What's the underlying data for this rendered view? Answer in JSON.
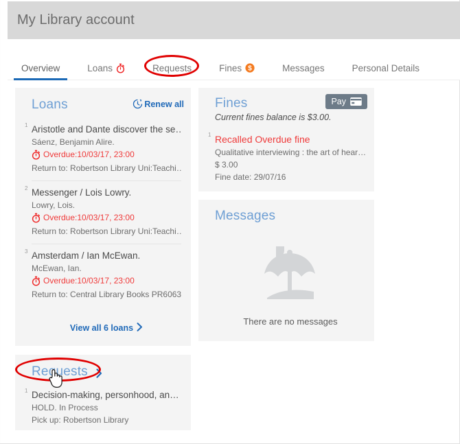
{
  "header": {
    "title": "My Library account"
  },
  "tabs": [
    {
      "label": "Overview",
      "icon": "",
      "active": true
    },
    {
      "label": "Loans",
      "icon": "stopwatch-icon",
      "active": false
    },
    {
      "label": "Requests",
      "icon": "",
      "active": false,
      "highlighted": true
    },
    {
      "label": "Fines",
      "icon": "dollar-badge-icon",
      "active": false
    },
    {
      "label": "Messages",
      "icon": "",
      "active": false
    },
    {
      "label": "Personal Details",
      "icon": "",
      "active": false
    }
  ],
  "loans_card": {
    "title": "Loans",
    "renew_all_label": "Renew all",
    "renew_all_icon": "renew-clock-icon",
    "items": [
      {
        "num": "1",
        "title": "Aristotle and Dante discover the se…",
        "author": "Sáenz, Benjamin Alire.",
        "overdue": "Overdue:10/03/17, 23:00",
        "return_to": "Return to: Robertson Library Uni:Teachi…"
      },
      {
        "num": "2",
        "title": "Messenger / Lois Lowry.",
        "author": "Lowry, Lois.",
        "overdue": "Overdue:10/03/17, 23:00",
        "return_to": "Return to: Robertson Library Uni:Teachi…"
      },
      {
        "num": "3",
        "title": "Amsterdam / Ian McEwan.",
        "author": "McEwan, Ian.",
        "overdue": "Overdue:10/03/17, 23:00",
        "return_to": "Return to: Central Library Books PR6063…"
      }
    ],
    "view_all_label": "View all 6 loans"
  },
  "fines_card": {
    "title": "Fines",
    "pay_label": "Pay",
    "pay_icon": "credit-card-icon",
    "balance": "Current fines balance is $3.00.",
    "items": [
      {
        "num": "1",
        "type": "Recalled Overdue fine",
        "title": "Qualitative interviewing : the art of hear…",
        "amount": "$ 3.00",
        "date": "Fine date: 29/07/16"
      }
    ]
  },
  "messages_card": {
    "title": "Messages",
    "empty_icon": "beach-umbrella-icon",
    "empty_text": "There are no messages"
  },
  "requests_card": {
    "title": "Requests",
    "chevron_icon": "chevron-right-icon",
    "items": [
      {
        "num": "1",
        "title": "Decision-making, personhood, an…",
        "status": "HOLD. In Process",
        "pickup": "Pick up: Robertson Library"
      }
    ]
  },
  "colors": {
    "header_bg": "#d8d8d8",
    "card_bg": "#f4f4f4",
    "accent_blue": "#1f69b8",
    "title_blue": "#6e9fd4",
    "overdue_red": "#ef3a3a",
    "annotation_red": "#e00000",
    "pay_btn": "#6d7b88",
    "fines_badge_orange": "#f47b20"
  }
}
